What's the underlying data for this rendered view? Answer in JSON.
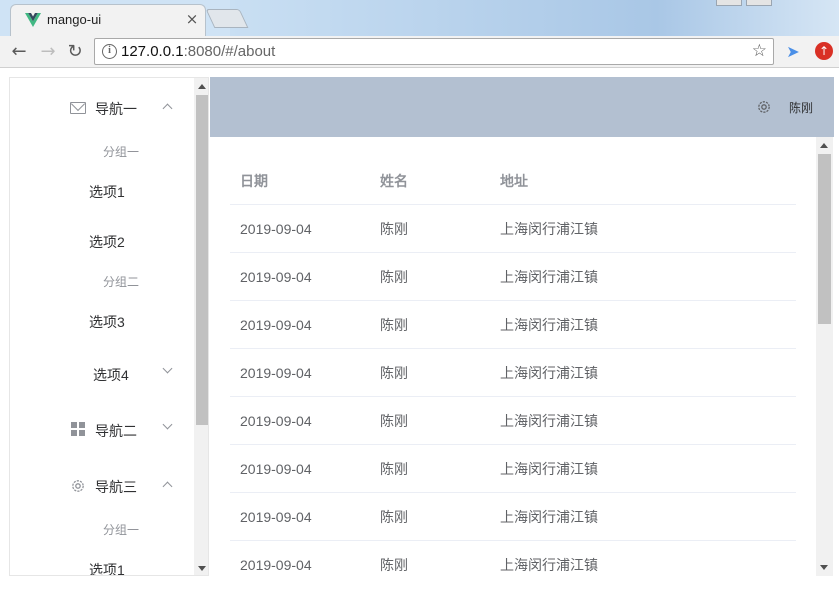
{
  "browser": {
    "tab_title": "mango-ui",
    "tab_close": "×",
    "url_host": "127.0.0.1",
    "url_rest": ":8080/#/about"
  },
  "sidebar": {
    "nav1": {
      "label": "导航一",
      "icon": "mail-icon",
      "expanded": true
    },
    "group1_title": "分组一",
    "option1": "选项1",
    "option2": "选项2",
    "group2_title": "分组二",
    "option3": "选项3",
    "option4": "选项4",
    "nav2": {
      "label": "导航二",
      "icon": "grid-icon",
      "expanded": false
    },
    "nav3": {
      "label": "导航三",
      "icon": "gear-icon",
      "expanded": true
    },
    "nav3_group1_title": "分组一",
    "nav3_option1": "选项1"
  },
  "header": {
    "user_name": "陈刚",
    "background": "#b3c0d1"
  },
  "table": {
    "columns": [
      "日期",
      "姓名",
      "地址"
    ],
    "rows": [
      [
        "2019-09-04",
        "陈刚",
        "上海闵行浦江镇"
      ],
      [
        "2019-09-04",
        "陈刚",
        "上海闵行浦江镇"
      ],
      [
        "2019-09-04",
        "陈刚",
        "上海闵行浦江镇"
      ],
      [
        "2019-09-04",
        "陈刚",
        "上海闵行浦江镇"
      ],
      [
        "2019-09-04",
        "陈刚",
        "上海闵行浦江镇"
      ],
      [
        "2019-09-04",
        "陈刚",
        "上海闵行浦江镇"
      ],
      [
        "2019-09-04",
        "陈刚",
        "上海闵行浦江镇"
      ],
      [
        "2019-09-04",
        "陈刚",
        "上海闵行浦江镇"
      ]
    ]
  }
}
